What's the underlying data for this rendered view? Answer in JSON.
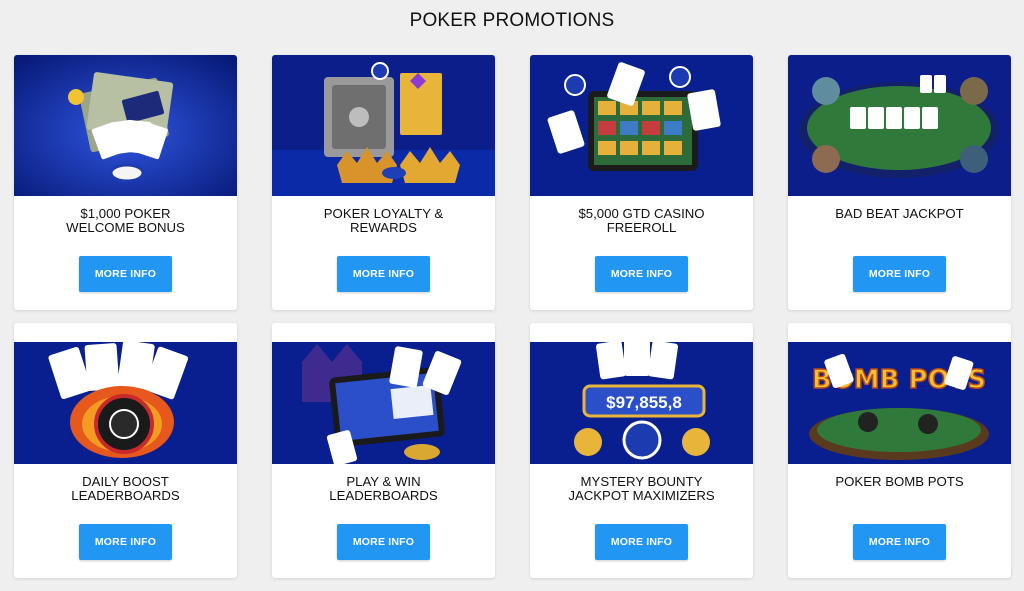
{
  "page": {
    "title": "POKER PROMOTIONS"
  },
  "promotions": [
    {
      "title": "$1,000 POKER\nWELCOME BONUS",
      "button": "MORE INFO",
      "image": "cash-and-cards-image"
    },
    {
      "title": "POKER LOYALTY &\nREWARDS",
      "button": "MORE INFO",
      "image": "safe-and-crowns-image"
    },
    {
      "title": "$5,000 GTD CASINO\nFREEROLL",
      "button": "MORE INFO",
      "image": "casino-slots-tablet-image"
    },
    {
      "title": "BAD BEAT JACKPOT",
      "button": "MORE INFO",
      "image": "poker-table-players-image"
    },
    {
      "title": "DAILY BOOST\nLEADERBOARDS",
      "button": "MORE INFO",
      "image": "flaming-chip-image"
    },
    {
      "title": "PLAY & WIN\nLEADERBOARDS",
      "button": "MORE INFO",
      "image": "leaderboard-laptop-image"
    },
    {
      "title": "MYSTERY BOUNTY\nJACKPOT MAXIMIZERS",
      "button": "MORE INFO",
      "image": "jackpot-counter-image",
      "counter": "$97,855,8"
    },
    {
      "title": "POKER BOMB POTS",
      "button": "MORE INFO",
      "image": "bomb-pots-table-image",
      "logo_text": "BOMB POTS"
    }
  ],
  "colors": {
    "banner_blue": "#0a1f8f",
    "button_blue": "#2196f3",
    "background": "#efefef"
  }
}
